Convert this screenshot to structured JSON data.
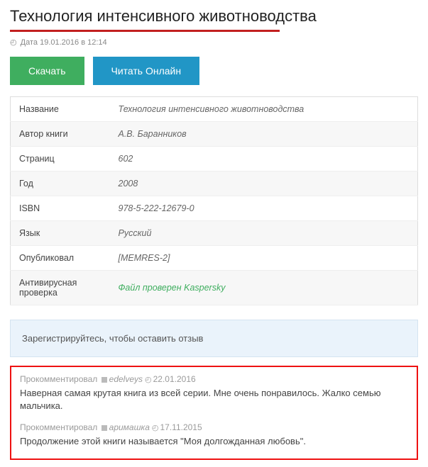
{
  "title": "Технология интенсивного животноводства",
  "date_prefix": "Дата",
  "date_value": "19.01.2016 в 12:14",
  "buttons": {
    "download": "Скачать",
    "read_online": "Читать Онлайн"
  },
  "info": {
    "rows": [
      {
        "label": "Название",
        "value": "Технология интенсивного животноводства"
      },
      {
        "label": "Автор книги",
        "value": "А.В. Баранников"
      },
      {
        "label": "Страниц",
        "value": "602"
      },
      {
        "label": "Год",
        "value": "2008"
      },
      {
        "label": "ISBN",
        "value": "978‐5‐222‐12679‐0"
      },
      {
        "label": "Язык",
        "value": "Русский"
      },
      {
        "label": "Опубликовал",
        "value": "[MEMRES‐2]"
      },
      {
        "label": "Антивирусная проверка",
        "value": "Файл проверен Kaspersky",
        "green": true
      }
    ]
  },
  "register_prompt": "Зарегистрируйтесь, чтобы оставить отзыв",
  "comment_prefix": "Прокомментировал",
  "comments": [
    {
      "author": "edelveys",
      "date": "22.01.2016",
      "text": "Наверная самая крутая книга из всей серии. Мне очень понравилось. Жалко семью мальчика."
    },
    {
      "author": "аримашка",
      "date": "17.11.2015",
      "text": "Продолжение этой книги называется \"Моя долгожданная любовь\"."
    }
  ]
}
